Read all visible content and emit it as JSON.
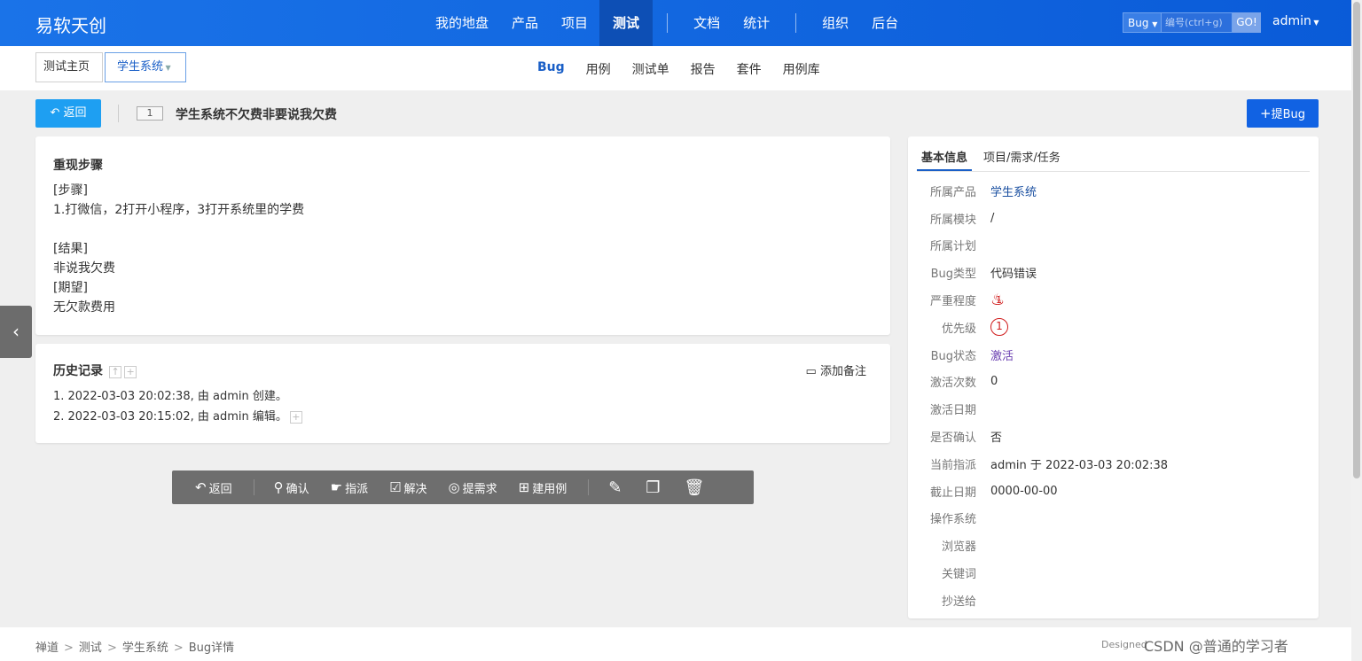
{
  "brand": "易软天创",
  "nav": {
    "items": [
      "我的地盘",
      "产品",
      "项目",
      "测试",
      "文档",
      "统计",
      "组织",
      "后台"
    ],
    "active": "测试"
  },
  "search": {
    "type": "Bug",
    "placeholder": "编号(ctrl+g)",
    "go": "GO!"
  },
  "user": "admin",
  "breadcrumb": {
    "home": "测试主页",
    "product": "学生系统"
  },
  "subnav": {
    "bug": "Bug",
    "cases": "用例",
    "testtask": "测试单",
    "report": "报告",
    "suite": "套件",
    "caselib": "用例库"
  },
  "toolbar": {
    "back": "返回",
    "add_bug": "提Bug"
  },
  "bug": {
    "id": "1",
    "title": "学生系统不欠费非要说我欠费"
  },
  "steps": {
    "title": "重现步骤",
    "lines": [
      "[步骤]",
      "1.打微信，2打开小程序，3打开系统里的学费",
      "",
      "[结果]",
      "非说我欠费",
      "[期望]",
      "无欠款费用"
    ]
  },
  "history": {
    "title": "历史记录",
    "add_note": "添加备注",
    "entries": [
      "1. 2022-03-03 20:02:38, 由 admin 创建。",
      "2. 2022-03-03 20:15:02, 由 admin 编辑。"
    ]
  },
  "actions": {
    "back": "返回",
    "confirm": "确认",
    "assign": "指派",
    "resolve": "解决",
    "story": "提需求",
    "case": "建用例"
  },
  "side": {
    "tabs": [
      "基本信息",
      "项目/需求/任务"
    ],
    "rows": [
      {
        "label": "所属产品",
        "value": "学生系统"
      },
      {
        "label": "所属模块",
        "value": "/"
      },
      {
        "label": "所属计划",
        "value": ""
      },
      {
        "label": "Bug类型",
        "value": "代码错误"
      },
      {
        "label": "严重程度",
        "value": "1"
      },
      {
        "label": "优先级",
        "value": "1"
      },
      {
        "label": "Bug状态",
        "value": "激活"
      },
      {
        "label": "激活次数",
        "value": "0"
      },
      {
        "label": "激活日期",
        "value": ""
      },
      {
        "label": "是否确认",
        "value": "否"
      },
      {
        "label": "当前指派",
        "value": "admin 于 2022-03-03 20:02:38"
      },
      {
        "label": "截止日期",
        "value": "0000-00-00"
      },
      {
        "label": "操作系统",
        "value": ""
      },
      {
        "label": "浏览器",
        "value": ""
      },
      {
        "label": "关键词",
        "value": ""
      },
      {
        "label": "抄送给",
        "value": ""
      }
    ]
  },
  "footer": {
    "crumbs": [
      "禅道",
      "测试",
      "学生系统",
      "Bug详情"
    ],
    "designed": "Designed",
    "watermark": "CSDN @普通的学习者"
  }
}
